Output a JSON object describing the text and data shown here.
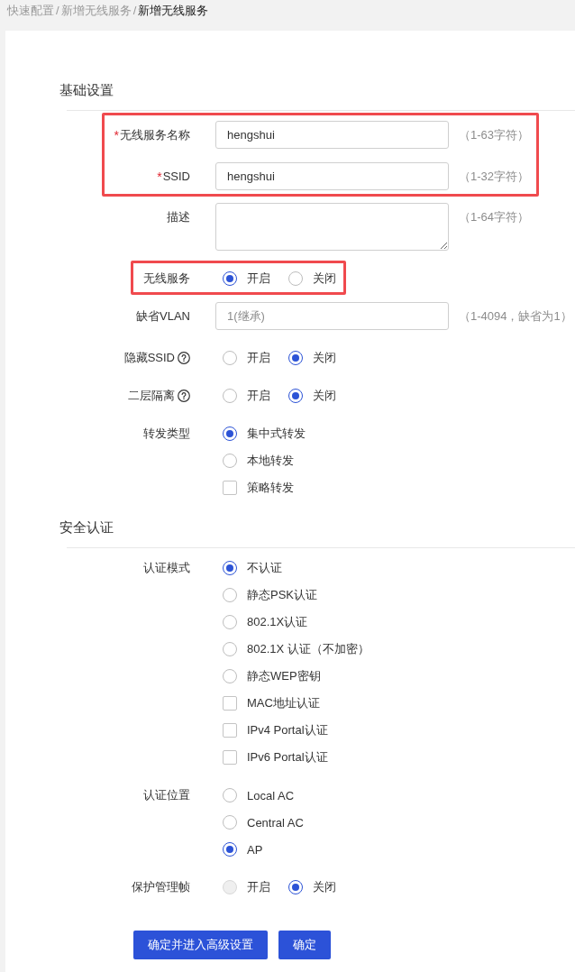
{
  "breadcrumb": [
    {
      "label": "快速配置",
      "separator": "/",
      "current": false
    },
    {
      "label": "新增无线服务",
      "separator": "/",
      "current": false
    },
    {
      "label": "新增无线服务",
      "current": true
    }
  ],
  "sections": [
    {
      "title": "基础设置",
      "rows": [
        {
          "kind": "group",
          "highlighted": true,
          "rows": [
            {
              "kind": "input",
              "label": "无线服务名称",
              "required_mark": "*",
              "value": "hengshui",
              "hint": "（1-63字符）"
            },
            {
              "kind": "input",
              "label": "SSID",
              "required_mark": "*",
              "value": "hengshui",
              "hint": "（1-32字符）"
            }
          ]
        },
        {
          "kind": "textarea",
          "label": "描述",
          "hint": "（1-64字符）"
        },
        {
          "kind": "group",
          "highlighted": true,
          "rows": [
            {
              "kind": "inline_choices",
              "label": "无线服务",
              "options": [
                {
                  "kind": "radio",
                  "label": "开启",
                  "selected": true
                },
                {
                  "kind": "radio",
                  "label": "关闭",
                  "selected": false
                }
              ]
            }
          ]
        },
        {
          "kind": "input",
          "label": "缺省VLAN",
          "placeholder": "1(继承)",
          "hint": "（1-4094，缺省为1）"
        },
        {
          "kind": "inline_choices",
          "label": "隐藏SSID",
          "help": true,
          "options": [
            {
              "kind": "radio",
              "label": "开启",
              "selected": false
            },
            {
              "kind": "radio",
              "label": "关闭",
              "selected": true
            }
          ]
        },
        {
          "kind": "inline_choices",
          "label": "二层隔离",
          "help": true,
          "options": [
            {
              "kind": "radio",
              "label": "开启",
              "selected": false
            },
            {
              "kind": "radio",
              "label": "关闭",
              "selected": true
            }
          ]
        },
        {
          "kind": "stacked_choices",
          "label": "转发类型",
          "options": [
            {
              "kind": "radio",
              "label": "集中式转发",
              "selected": true
            },
            {
              "kind": "radio",
              "label": "本地转发",
              "selected": false
            },
            {
              "kind": "checkbox",
              "label": "策略转发",
              "checked": false
            }
          ]
        }
      ]
    },
    {
      "title": "安全认证",
      "rows": [
        {
          "kind": "stacked_choices",
          "label": "认证模式",
          "options": [
            {
              "kind": "radio",
              "label": "不认证",
              "selected": true
            },
            {
              "kind": "radio",
              "label": "静态PSK认证",
              "selected": false
            },
            {
              "kind": "radio",
              "label": "802.1X认证",
              "selected": false
            },
            {
              "kind": "radio",
              "label": "802.1X 认证（不加密）",
              "selected": false
            },
            {
              "kind": "radio",
              "label": "静态WEP密钥",
              "selected": false
            },
            {
              "kind": "checkbox",
              "label": "MAC地址认证",
              "checked": false
            },
            {
              "kind": "checkbox",
              "label": "IPv4 Portal认证",
              "checked": false
            },
            {
              "kind": "checkbox",
              "label": "IPv6 Portal认证",
              "checked": false
            }
          ]
        },
        {
          "kind": "stacked_choices",
          "label": "认证位置",
          "options": [
            {
              "kind": "radio",
              "label": "Local AC",
              "selected": false
            },
            {
              "kind": "radio",
              "label": "Central AC",
              "selected": false
            },
            {
              "kind": "radio",
              "label": "AP",
              "selected": true
            }
          ]
        },
        {
          "kind": "inline_choices",
          "label": "保护管理帧",
          "options": [
            {
              "kind": "radio",
              "label": "开启",
              "selected": false,
              "disabled": true
            },
            {
              "kind": "radio",
              "label": "关闭",
              "selected": true,
              "disabled": false
            }
          ]
        }
      ]
    }
  ],
  "buttons": [
    {
      "label": "确定并进入高级设置"
    },
    {
      "label": "确定"
    }
  ]
}
